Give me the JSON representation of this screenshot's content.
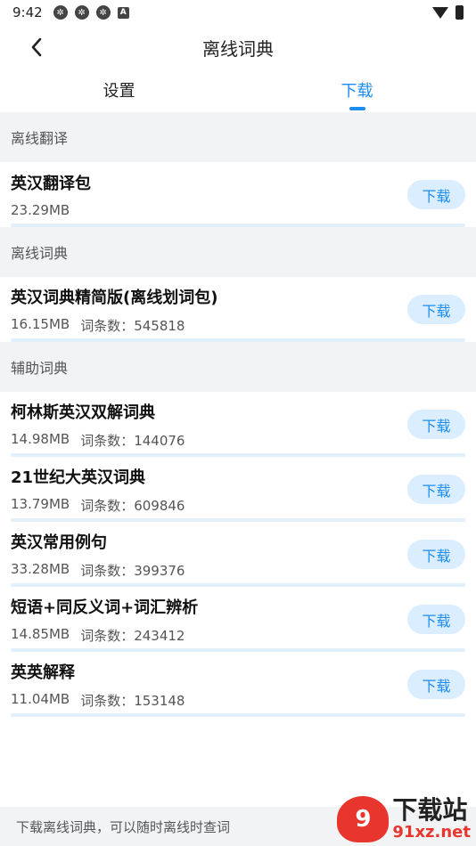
{
  "status": {
    "time": "9:42"
  },
  "header": {
    "title": "离线词典"
  },
  "tabs": [
    {
      "label": "设置",
      "active": false
    },
    {
      "label": "下载",
      "active": true
    }
  ],
  "sections": [
    {
      "title": "离线翻译",
      "items": [
        {
          "name": "英汉翻译包",
          "size": "23.29MB",
          "count": "",
          "button": "下载"
        }
      ]
    },
    {
      "title": "离线词典",
      "items": [
        {
          "name": "英汉词典精简版(离线划词包)",
          "size": "16.15MB",
          "count": "词条数：545818",
          "button": "下载"
        }
      ]
    },
    {
      "title": "辅助词典",
      "items": [
        {
          "name": "柯林斯英汉双解词典",
          "size": "14.98MB",
          "count": "词条数：144076",
          "button": "下载"
        },
        {
          "name": "21世纪大英汉词典",
          "size": "13.79MB",
          "count": "词条数：609846",
          "button": "下载"
        },
        {
          "name": "英汉常用例句",
          "size": "33.28MB",
          "count": "词条数：399376",
          "button": "下载"
        },
        {
          "name": "短语+同反义词+词汇辨析",
          "size": "14.85MB",
          "count": "词条数：243412",
          "button": "下载"
        },
        {
          "name": "英英解释",
          "size": "11.04MB",
          "count": "词条数：153148",
          "button": "下载"
        }
      ]
    }
  ],
  "footer": {
    "hint": "下载离线词典，可以随时离线时查词"
  },
  "watermark": {
    "logo_text": "9",
    "title": "下载站",
    "url": "91xz.net"
  },
  "colors": {
    "accent": "#1e8df0",
    "button_bg": "#daeeff",
    "section_bg": "#f2f3f5"
  }
}
